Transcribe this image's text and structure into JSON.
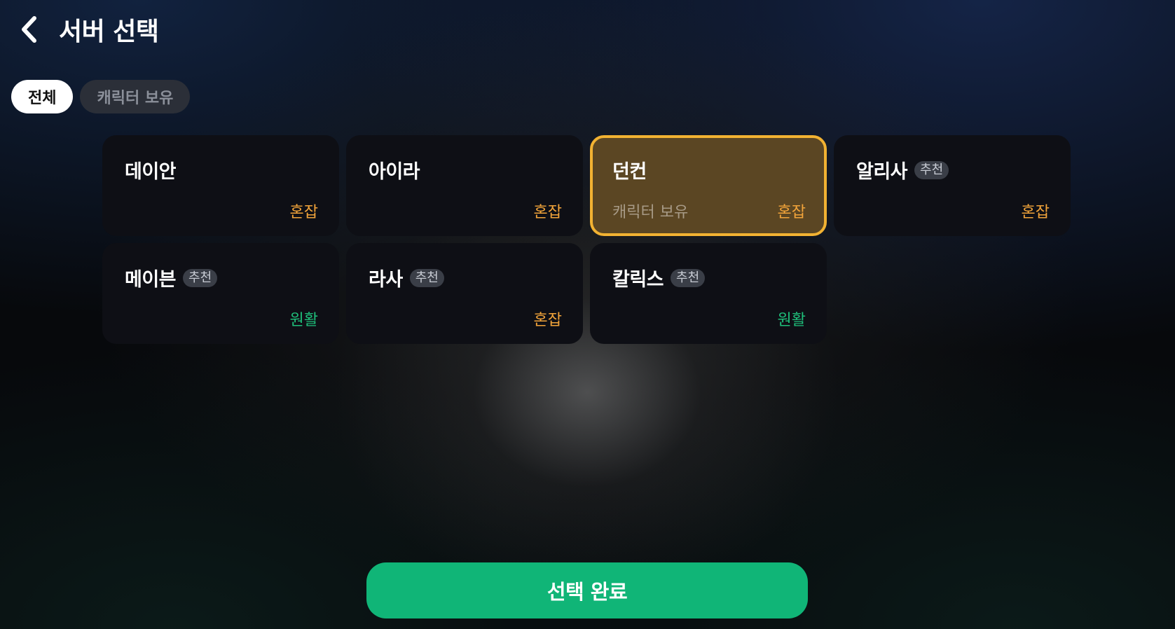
{
  "header": {
    "title": "서버 선택",
    "back_icon": "chevron-left-icon"
  },
  "filters": [
    {
      "label": "전체",
      "active": true
    },
    {
      "label": "캐릭터 보유",
      "active": false
    }
  ],
  "servers": [
    {
      "name": "데이안",
      "badge": "",
      "owned": "",
      "status": "혼잡"
    },
    {
      "name": "아이라",
      "badge": "",
      "owned": "",
      "status": "혼잡"
    },
    {
      "name": "던컨",
      "badge": "",
      "owned": "캐릭터 보유",
      "status": "혼잡"
    },
    {
      "name": "알리사",
      "badge": "추천",
      "owned": "",
      "status": "혼잡"
    },
    {
      "name": "메이븐",
      "badge": "추천",
      "owned": "",
      "status": "원활"
    },
    {
      "name": "라사",
      "badge": "추천",
      "owned": "",
      "status": "혼잡"
    },
    {
      "name": "칼릭스",
      "badge": "추천",
      "owned": "",
      "status": "원활"
    }
  ],
  "selected_server": "던컨",
  "confirm_label": "선택 완료",
  "colors": {
    "accent_green": "#10b577",
    "selected_border": "#f2b232",
    "status_busy": "#f2a43a",
    "status_smooth": "#1fbf7a"
  }
}
